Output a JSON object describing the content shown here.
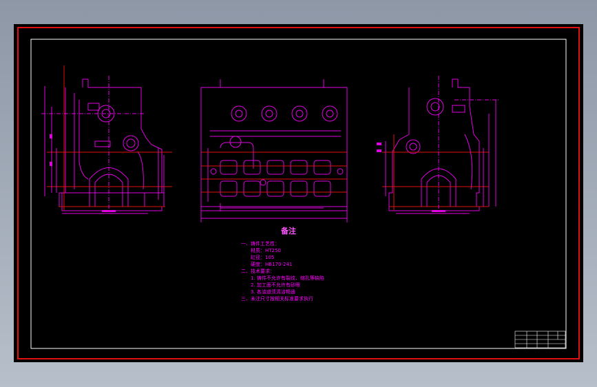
{
  "drawing": {
    "background_color": "#000000",
    "line_color": "#e000e0",
    "border_color": "#e01010",
    "frame_color": "#ffffff"
  },
  "notes": {
    "title": "备注",
    "lines": [
      "一、铸件工艺性：",
      "材质：HT250",
      "缸径：105",
      "硬度：HB170-241",
      "二、技术要求：",
      "1. 铸件不允许有裂纹、缩孔等缺陷",
      "2. 加工面不允许有砂眼",
      "3. 各油道须清洁畅通",
      "三、未注尺寸按相关标准要求执行"
    ]
  },
  "title_block": {
    "cells": [
      "",
      "",
      "",
      ""
    ]
  }
}
